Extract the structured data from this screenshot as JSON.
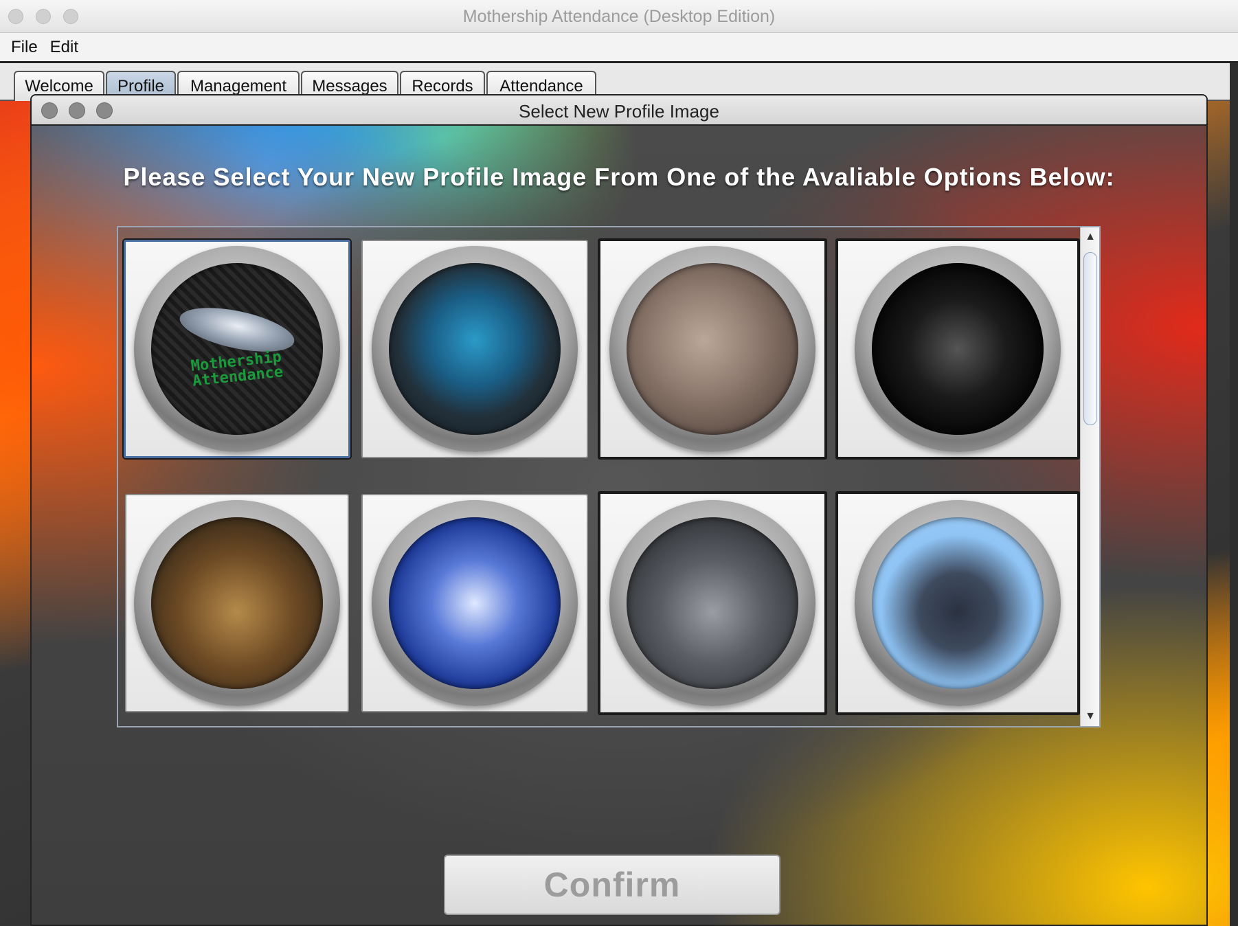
{
  "window": {
    "title": "Mothership Attendance (Desktop Edition)"
  },
  "menubar": {
    "items": [
      "File",
      "Edit"
    ]
  },
  "tabs": [
    {
      "label": "Welcome"
    },
    {
      "label": "Profile",
      "active": true
    },
    {
      "label": "Management"
    },
    {
      "label": "Messages"
    },
    {
      "label": "Records"
    },
    {
      "label": "Attendance"
    }
  ],
  "dialog": {
    "title": "Select New Profile Image",
    "heading": "Please Select Your New Profile Image From One of the Avaliable Options Below:",
    "confirm_label": "Confirm",
    "images": [
      {
        "icon": "ufo-image-icon",
        "logo_line1": "Mothership",
        "logo_line2": "Attendance",
        "selected": true
      },
      {
        "icon": "blue-truck-image-icon"
      },
      {
        "icon": "dinosaur-image-icon"
      },
      {
        "icon": "stealth-jet-image-icon"
      },
      {
        "icon": "lions-image-icon"
      },
      {
        "icon": "ice-cave-image-icon"
      },
      {
        "icon": "sports-car-image-icon"
      },
      {
        "icon": "helicopter-image-icon"
      }
    ]
  },
  "colors": {
    "active_tab": "#a9bccf",
    "selected_border": "#4a6da0",
    "confirm_text": "#9c9c9c"
  }
}
